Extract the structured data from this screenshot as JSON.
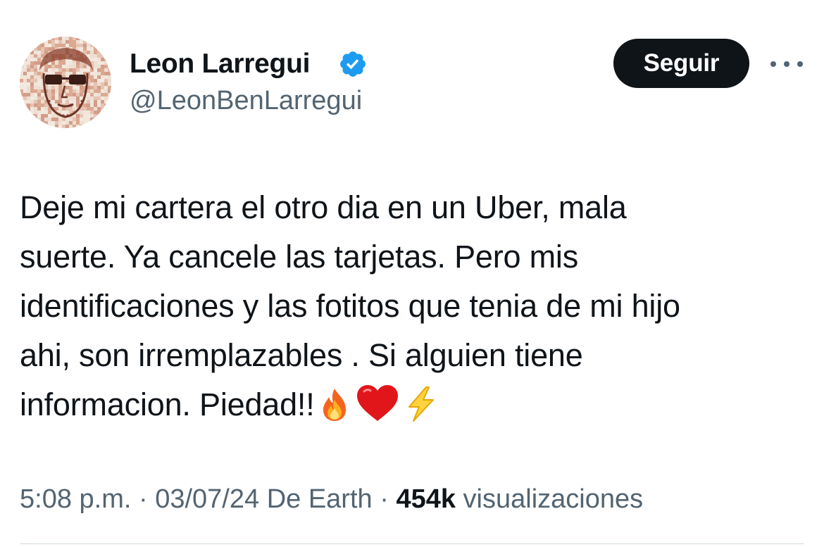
{
  "author": {
    "display_name": "Leon Larregui",
    "handle": "@LeonBenLarregui",
    "verified": true,
    "avatar_icon": "avatar-mosaic-portrait"
  },
  "actions": {
    "follow_label": "Seguir",
    "more_icon": "more-horizontal-icon"
  },
  "tweet": {
    "text_lines": [
      "Deje mi cartera el otro dia en un Uber, mala",
      "suerte. Ya cancele las tarjetas. Pero mis",
      "identificaciones y las fotitos que tenia de mi hijo",
      "ahi, son irremplazables . Si alguien tiene",
      "informacion. Piedad!!"
    ],
    "emojis": [
      "fire-emoji",
      "red-heart-emoji",
      "lightning-emoji"
    ]
  },
  "meta": {
    "time": "5:08 p.m.",
    "separator": " · ",
    "date": "03/07/24",
    "source": "De Earth",
    "views_count": "454k",
    "views_label": "visualizaciones"
  },
  "colors": {
    "primary_text": "#0f1419",
    "secondary_text": "#536471",
    "verified_blue": "#1d9bf0",
    "button_bg": "#0f1419",
    "divider": "#cfd9de"
  }
}
